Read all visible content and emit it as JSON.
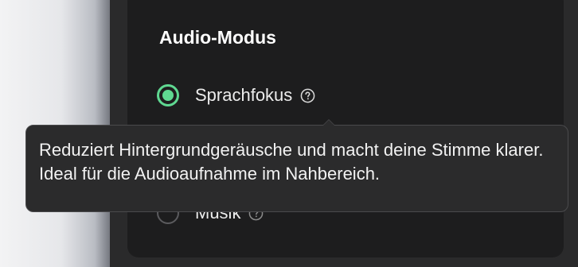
{
  "panel": {
    "title": "Audio-Modus",
    "options": [
      {
        "label": "Sprachfokus",
        "selected": true,
        "help_icon": "question-circle-icon"
      },
      {
        "label": "Musik",
        "selected": false,
        "help_icon": "question-circle-icon"
      }
    ]
  },
  "tooltip": {
    "text": "Reduziert Hintergrundgeräusche und macht deine Stimme klarer. Ideal für die Audioaufnahme im Nahbereich."
  },
  "colors": {
    "accent": "#5fd891",
    "panel_bg": "#1d1d1e",
    "tooltip_bg": "#2b2b2c"
  }
}
